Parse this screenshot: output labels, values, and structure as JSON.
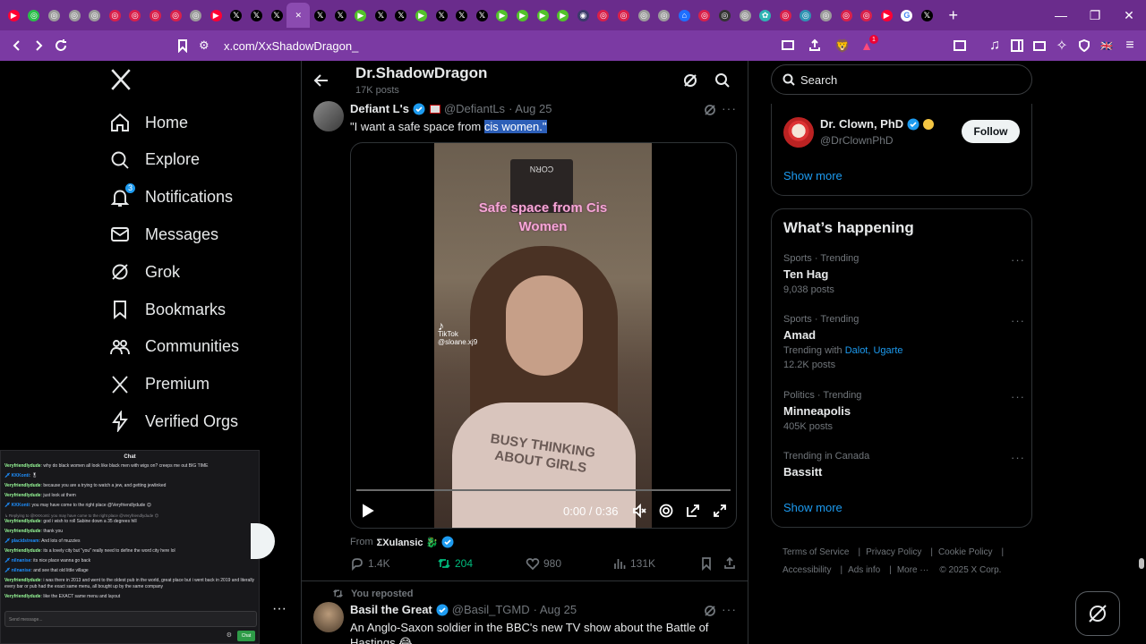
{
  "browser": {
    "url": "x.com/XxShadowDragon_",
    "shields_badge": "1",
    "tabs": [
      {
        "icon": "youtube-icon",
        "color": "#ff0033",
        "glyph": "▶"
      },
      {
        "icon": "green-circle-icon",
        "color": "#2bbf4a",
        "glyph": "◎"
      },
      {
        "icon": "grey-circle-icon",
        "color": "#9b9b9b",
        "glyph": "◎"
      },
      {
        "icon": "grey-circle-icon",
        "color": "#9b9b9b",
        "glyph": "◎"
      },
      {
        "icon": "grey-circle-icon",
        "color": "#9b9b9b",
        "glyph": "◎"
      },
      {
        "icon": "red-circle-icon",
        "color": "#d9204a",
        "glyph": "◎"
      },
      {
        "icon": "red-circle-icon",
        "color": "#d9204a",
        "glyph": "◎"
      },
      {
        "icon": "red-circle-icon",
        "color": "#d9204a",
        "glyph": "◎"
      },
      {
        "icon": "red-circle-icon",
        "color": "#d9204a",
        "glyph": "◎"
      },
      {
        "icon": "grey-circle-icon",
        "color": "#9b9b9b",
        "glyph": "◎"
      },
      {
        "icon": "youtube-icon",
        "color": "#ff0033",
        "glyph": "▶"
      },
      {
        "icon": "x-icon",
        "color": "#000000",
        "glyph": "𝕏"
      },
      {
        "icon": "x-icon",
        "color": "#000000",
        "glyph": "𝕏"
      },
      {
        "icon": "x-icon",
        "color": "#000000",
        "glyph": "𝕏"
      },
      {
        "icon": "x-icon-active",
        "color": "#8b4bb0",
        "glyph": "✕",
        "active": true
      },
      {
        "icon": "x-icon",
        "color": "#000000",
        "glyph": "𝕏"
      },
      {
        "icon": "x-icon",
        "color": "#000000",
        "glyph": "𝕏"
      },
      {
        "icon": "play-icon",
        "color": "#53c22b",
        "glyph": "▶"
      },
      {
        "icon": "x-icon",
        "color": "#000000",
        "glyph": "𝕏"
      },
      {
        "icon": "x-icon",
        "color": "#000000",
        "glyph": "𝕏"
      },
      {
        "icon": "play-icon",
        "color": "#53c22b",
        "glyph": "▶"
      },
      {
        "icon": "x-icon",
        "color": "#000000",
        "glyph": "𝕏"
      },
      {
        "icon": "x-icon",
        "color": "#000000",
        "glyph": "𝕏"
      },
      {
        "icon": "x-icon",
        "color": "#000000",
        "glyph": "𝕏"
      },
      {
        "icon": "play-icon",
        "color": "#53c22b",
        "glyph": "▶"
      },
      {
        "icon": "play-icon",
        "color": "#53c22b",
        "glyph": "▶"
      },
      {
        "icon": "play-icon",
        "color": "#53c22b",
        "glyph": "▶"
      },
      {
        "icon": "play-icon",
        "color": "#53c22b",
        "glyph": "▶"
      },
      {
        "icon": "dark-tab-icon",
        "color": "#3a3a6a",
        "glyph": "◉"
      },
      {
        "icon": "red-circle-icon",
        "color": "#d9204a",
        "glyph": "◎"
      },
      {
        "icon": "red-circle-icon",
        "color": "#d9204a",
        "glyph": "◎"
      },
      {
        "icon": "grey-circle-icon",
        "color": "#9b9b9b",
        "glyph": "◎"
      },
      {
        "icon": "grey-circle-icon",
        "color": "#9b9b9b",
        "glyph": "◎"
      },
      {
        "icon": "blue-house-icon",
        "color": "#1e6fff",
        "glyph": "⌂"
      },
      {
        "icon": "red-circle-icon",
        "color": "#d9204a",
        "glyph": "◎"
      },
      {
        "icon": "dark-circle-icon",
        "color": "#333333",
        "glyph": "◎"
      },
      {
        "icon": "grey-circle-icon",
        "color": "#9b9b9b",
        "glyph": "◎"
      },
      {
        "icon": "teal-icon",
        "color": "#2fb3b3",
        "glyph": "✿"
      },
      {
        "icon": "red-circle-icon",
        "color": "#d9204a",
        "glyph": "◎"
      },
      {
        "icon": "teal-icon",
        "color": "#2f93b3",
        "glyph": "◎"
      },
      {
        "icon": "grey-circle-icon",
        "color": "#9b9b9b",
        "glyph": "◎"
      },
      {
        "icon": "red-circle-icon",
        "color": "#d9204a",
        "glyph": "◎"
      },
      {
        "icon": "red-circle-icon",
        "color": "#d9204a",
        "glyph": "◎"
      },
      {
        "icon": "youtube-icon",
        "color": "#ff0033",
        "glyph": "▶"
      },
      {
        "icon": "google-icon",
        "color": "#ffffff",
        "glyph": "G"
      },
      {
        "icon": "x-icon",
        "color": "#000000",
        "glyph": "𝕏"
      }
    ]
  },
  "nav": {
    "items": [
      {
        "id": "home",
        "label": "Home"
      },
      {
        "id": "explore",
        "label": "Explore"
      },
      {
        "id": "notifications",
        "label": "Notifications",
        "badge": "3"
      },
      {
        "id": "messages",
        "label": "Messages"
      },
      {
        "id": "grok",
        "label": "Grok"
      },
      {
        "id": "bookmarks",
        "label": "Bookmarks"
      },
      {
        "id": "communities",
        "label": "Communities"
      },
      {
        "id": "premium",
        "label": "Premium"
      },
      {
        "id": "verified-orgs",
        "label": "Verified Orgs"
      }
    ]
  },
  "chat": {
    "title": "Chat",
    "input_placeholder": "Send message...",
    "send_label": "Chat",
    "messages": [
      {
        "user": "Veryfriendlydude",
        "text": ": why do black women all look like black men with wigs on? creeps me out BIG TIME"
      },
      {
        "user": "KKKonti",
        "text": ": 🎖",
        "blue": true
      },
      {
        "user": "Veryfriendlydude",
        "text": ": because you are a trying to watch a jew, and getting jewlinked"
      },
      {
        "user": "Veryfriendlydude",
        "text": ": just look at them"
      },
      {
        "user": "KKKonti",
        "text": ": you may have come to the right place @Veryfriendlydude 😊",
        "blue": true
      },
      {
        "user": "Veryfriendlydude",
        "text": ": god i wish to roll Sabine down a 35 degrees hill",
        "reply": "↳ Replying to @KKKonti: you may have come to the right place @Veryfriendlydude 😊"
      },
      {
        "user": "Veryfriendlydude",
        "text": ": thank you"
      },
      {
        "user": "placidstream",
        "text": ": And lots of muzzies",
        "blue": true
      },
      {
        "user": "Veryfriendlydude",
        "text": ": its a lovely city but \"you\" really need to define the word city here lol"
      },
      {
        "user": "nilnanise",
        "text": ": its nice place wanna go back",
        "blue": true
      },
      {
        "user": "nilnanise",
        "text": ": and see that old little village",
        "blue": true
      },
      {
        "user": "Veryfriendlydude",
        "text": ": i was there in 2013 and went to the oldest pub in the world, great place but i went back in 2019 and literally every bar or pub had the exact same menu, all bought up by the same company"
      },
      {
        "user": "Veryfriendlydude",
        "text": ": like the EXACT same menu and layout"
      }
    ]
  },
  "header": {
    "title": "Dr.ShadowDragon",
    "subtitle": "17K posts"
  },
  "tweet1": {
    "name": "Defiant L's",
    "handle": "@DefiantLs",
    "date": "· Aug 25",
    "text_before": "\"I want a safe space from ",
    "text_highlight": "cis women.\"",
    "video_overlay_line1": "Safe space from Cis",
    "video_overlay_line2": "Women",
    "tiktok_label": "TikTok",
    "tiktok_handle": "@sloane.xj9",
    "poster_text": "CORN",
    "shirt_text": "BUSY THINKING ABOUT GIRLS",
    "video_time": "0:00 / 0:36",
    "from_label": "From",
    "from_name": "ΣXulansic 🐉",
    "replies": "1.4K",
    "reposts": "204",
    "likes": "980",
    "views": "131K"
  },
  "tweet2": {
    "reposted_label": "You reposted",
    "name": "Basil the Great",
    "handle": "@Basil_TGMD",
    "date": "· Aug 25",
    "text": "An Anglo-Saxon soldier in the BBC's new TV show about the Battle of Hastings 😂"
  },
  "right": {
    "search_placeholder": "Search",
    "wtf": {
      "name": "Dr. Clown, PhD",
      "handle": "@DrClownPhD",
      "follow_label": "Follow",
      "show_more": "Show more"
    },
    "happening": {
      "title": "What’s happening",
      "trends": [
        {
          "category": "Sports · Trending",
          "name": "Ten Hag",
          "posts": "9,038 posts"
        },
        {
          "category": "Sports · Trending",
          "name": "Amad",
          "trending_with_label": "Trending with",
          "trending_with": "Dalot, Ugarte",
          "posts": "12.2K posts"
        },
        {
          "category": "Politics · Trending",
          "name": "Minneapolis",
          "posts": "405K posts"
        },
        {
          "category": "Trending in Canada",
          "name": "Bassitt"
        }
      ],
      "show_more": "Show more"
    },
    "footer": {
      "links": [
        "Terms of Service",
        "Privacy Policy",
        "Cookie Policy",
        "Accessibility",
        "Ads info",
        "More ···"
      ],
      "copyright": "© 2025 X Corp."
    }
  }
}
